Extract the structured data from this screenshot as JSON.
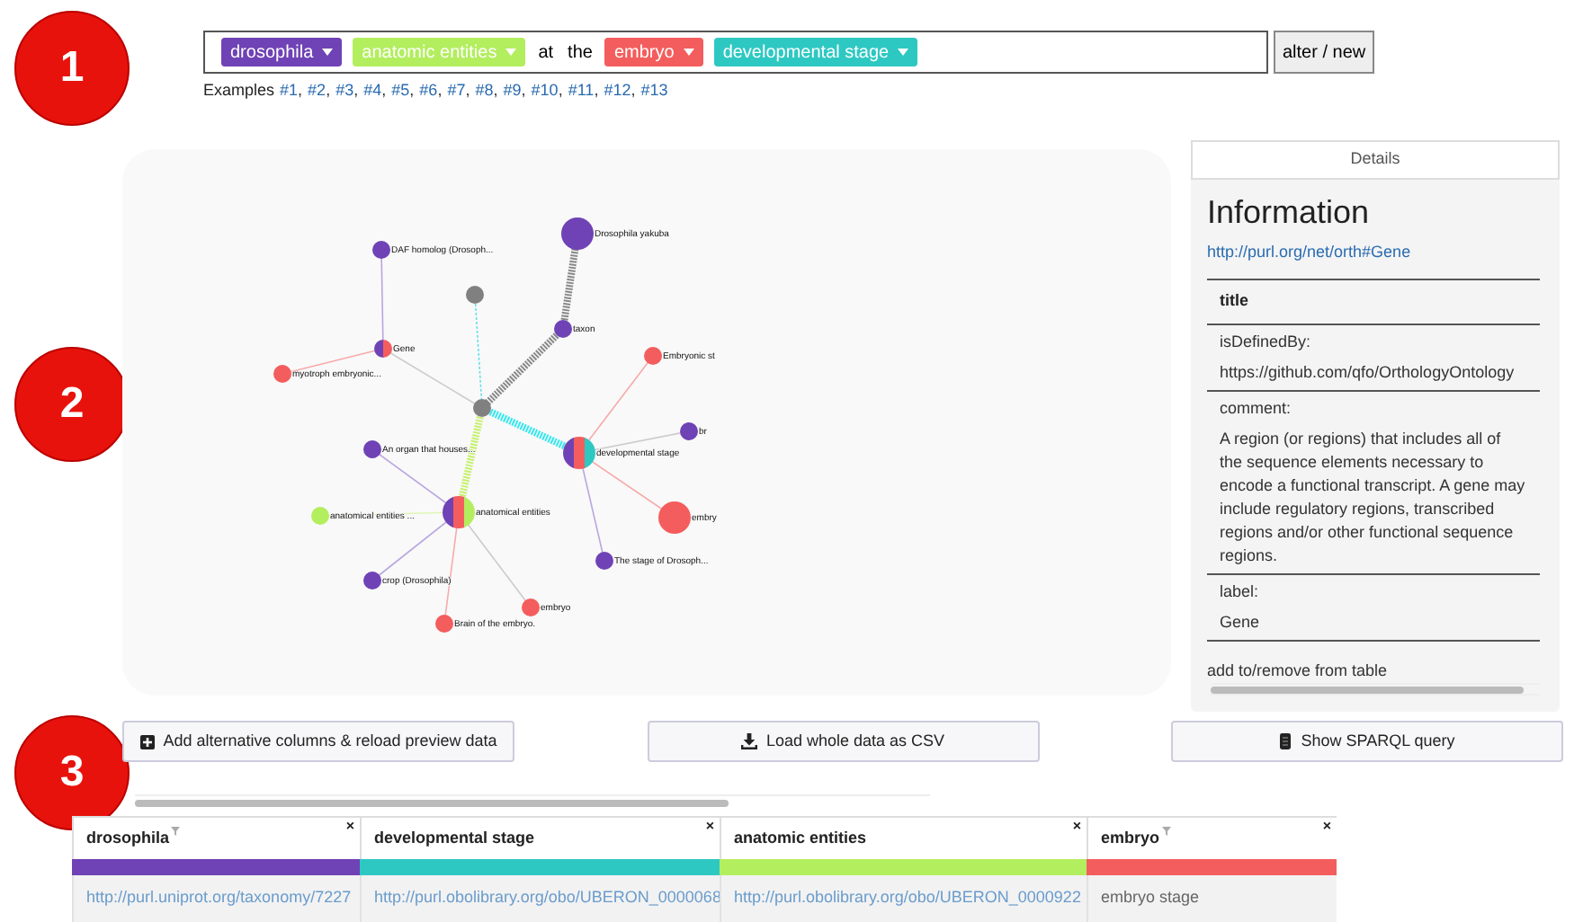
{
  "callouts": [
    "1",
    "2",
    "3"
  ],
  "query": {
    "tags": [
      {
        "label": "drosophila",
        "color": "#6f42b5"
      },
      {
        "label": "anatomic entities",
        "color": "#b3ee5e"
      },
      {
        "kind": "word",
        "label": "at"
      },
      {
        "kind": "word",
        "label": "the"
      },
      {
        "label": "embryo",
        "color": "#f45d5d"
      },
      {
        "label": "developmental stage",
        "color": "#2ec8c2"
      }
    ],
    "button": "alter / new"
  },
  "examples": {
    "label": "Examples",
    "separator": ",",
    "links": [
      "#1",
      "#2",
      "#3",
      "#4",
      "#5",
      "#6",
      "#7",
      "#8",
      "#9",
      "#10",
      "#11",
      "#12",
      "#13"
    ]
  },
  "graph": {
    "nodes": [
      {
        "label": "Drosophila yakuba",
        "color": "#6f42b5"
      },
      {
        "label": "DAF homolog (Drosoph...",
        "color": "#6f42b5"
      },
      {
        "color": "#808080"
      },
      {
        "label": "taxon",
        "color": "#6f42b5"
      },
      {
        "label": "Gene",
        "segments": [
          {
            "color": "#6f42b5"
          },
          {
            "color": "#f45d5d"
          }
        ]
      },
      {
        "label": "myotroph embryonic...",
        "color": "#f45d5d"
      },
      {
        "label": "Embryonic st",
        "color": "#f45d5d"
      },
      {
        "color": "#808080"
      },
      {
        "label": "developmental stage",
        "segments": [
          {
            "color": "#6f42b5"
          },
          {
            "color": "#f45d5d"
          },
          {
            "color": "#2ec8c2"
          }
        ]
      },
      {
        "label": "br",
        "color": "#6f42b5"
      },
      {
        "label": "An organ that houses...",
        "color": "#6f42b5"
      },
      {
        "label": "anatomical entities",
        "segments": [
          {
            "color": "#6f42b5"
          },
          {
            "color": "#f45d5d"
          },
          {
            "color": "#b3ee5e"
          }
        ]
      },
      {
        "label": "anatomical entities ...",
        "color": "#b3ee5e"
      },
      {
        "label": "embry",
        "color": "#f45d5d"
      },
      {
        "label": "The stage of Drosoph...",
        "color": "#6f42b5"
      },
      {
        "label": "crop (Drosophila)",
        "color": "#6f42b5"
      },
      {
        "label": "embryo",
        "color": "#f45d5d"
      },
      {
        "label": "Brain of the embryo.",
        "color": "#f45d5d"
      }
    ],
    "edges": [
      {
        "kind": "thick",
        "color": "#888888"
      },
      {
        "kind": "thick",
        "color": "#888888"
      },
      {
        "kind": "dotted",
        "color": "#66e0e8"
      },
      {
        "kind": "thin",
        "color": "#cccccc"
      },
      {
        "kind": "thin",
        "color": "#b9a6e0"
      },
      {
        "kind": "thin",
        "color": "#f7aaaa"
      },
      {
        "kind": "thick",
        "color": "#33e8ee"
      },
      {
        "kind": "thick",
        "color": "#c6f06e"
      },
      {
        "kind": "thin",
        "color": "#f7aaaa"
      },
      {
        "kind": "thin",
        "color": "#cccccc"
      },
      {
        "kind": "thin",
        "color": "#f7aaaa"
      },
      {
        "kind": "thin",
        "color": "#b9a6e0"
      },
      {
        "kind": "thin",
        "color": "#b9a6e0"
      },
      {
        "kind": "thin",
        "color": "#dff5b8"
      },
      {
        "kind": "thin",
        "color": "#b9a6e0"
      },
      {
        "kind": "thin",
        "color": "#f7aaaa"
      },
      {
        "kind": "thin",
        "color": "#cccccc"
      }
    ]
  },
  "details": {
    "tab": "Details",
    "heading": "Information",
    "uri": "http://purl.org/net/orth#Gene",
    "title_header": "title",
    "fields": [
      {
        "label": "isDefinedBy:",
        "value": "https://github.com/qfo/OrthologyOntology"
      },
      {
        "label": "comment:",
        "value": "A region (or regions) that includes all of the sequence elements necessary to encode a functional transcript. A gene may include regulatory regions, transcribed regions and/or other functional sequence regions."
      },
      {
        "label": "label:",
        "value": "Gene"
      }
    ],
    "footer": "add to/remove from table"
  },
  "actions": [
    {
      "kind": "plus",
      "label": "Add alternative columns & reload preview data"
    },
    {
      "kind": "download",
      "label": "Load whole data as CSV"
    },
    {
      "kind": "code",
      "label": "Show SPARQL query"
    }
  ],
  "table": {
    "columns": [
      {
        "name": "drosophila",
        "color": "#6f42b5",
        "filter": true
      },
      {
        "name": "developmental stage",
        "color": "#2ec8c2",
        "filter": false
      },
      {
        "name": "anatomic entities",
        "color": "#b3ee5e",
        "filter": false
      },
      {
        "name": "embryo",
        "color": "#f45d5d",
        "filter": true
      }
    ],
    "close": "×",
    "rows": [
      [
        {
          "kind": "link",
          "text": "http://purl.uniprot.org/taxonomy/7227"
        },
        {
          "kind": "link",
          "text": "http://purl.obolibrary.org/obo/UBERON_0000068"
        },
        {
          "kind": "link",
          "text": "http://purl.obolibrary.org/obo/UBERON_0000922"
        },
        {
          "kind": "text",
          "text": "embryo stage"
        }
      ]
    ]
  }
}
